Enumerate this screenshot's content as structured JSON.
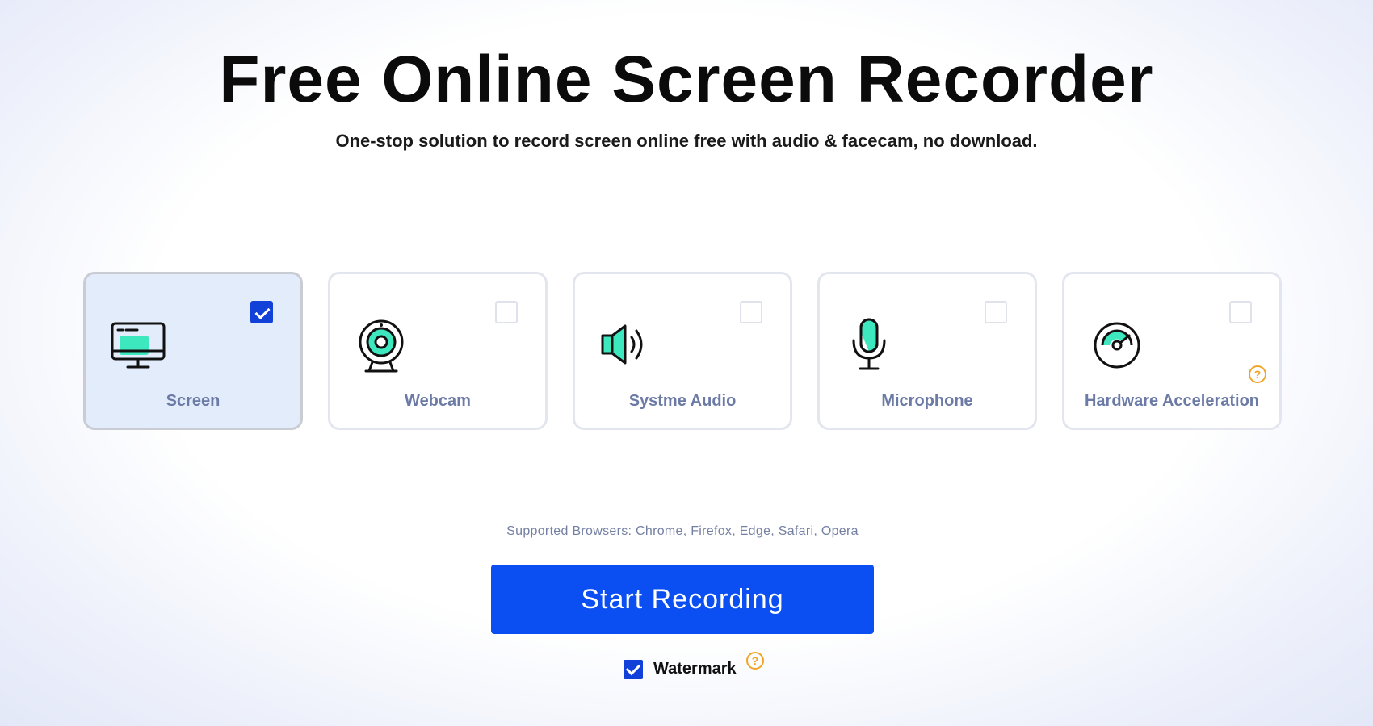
{
  "header": {
    "title": "Free Online Screen Recorder",
    "subtitle": "One-stop solution to record screen online free with audio & facecam, no download."
  },
  "options": [
    {
      "label": "Screen",
      "icon": "monitor-icon",
      "checked": true
    },
    {
      "label": "Webcam",
      "icon": "webcam-icon",
      "checked": false
    },
    {
      "label": "Systme Audio",
      "icon": "speaker-icon",
      "checked": false
    },
    {
      "label": "Microphone",
      "icon": "microphone-icon",
      "checked": false
    },
    {
      "label": "Hardware Acceleration",
      "icon": "speedometer-icon",
      "checked": false,
      "help": "?"
    }
  ],
  "supported_browsers": "Supported Browsers: Chrome, Firefox, Edge, Safari, Opera",
  "start_button": {
    "label": "Start Recording"
  },
  "watermark": {
    "label": "Watermark",
    "checked": true,
    "help": "?"
  },
  "colors": {
    "primary": "#0b4ff2",
    "checkbox": "#1241d9",
    "accent_mint": "#3ee8bf",
    "help_orange": "#f0a526",
    "selected_card_bg": "#e3ecfb"
  }
}
